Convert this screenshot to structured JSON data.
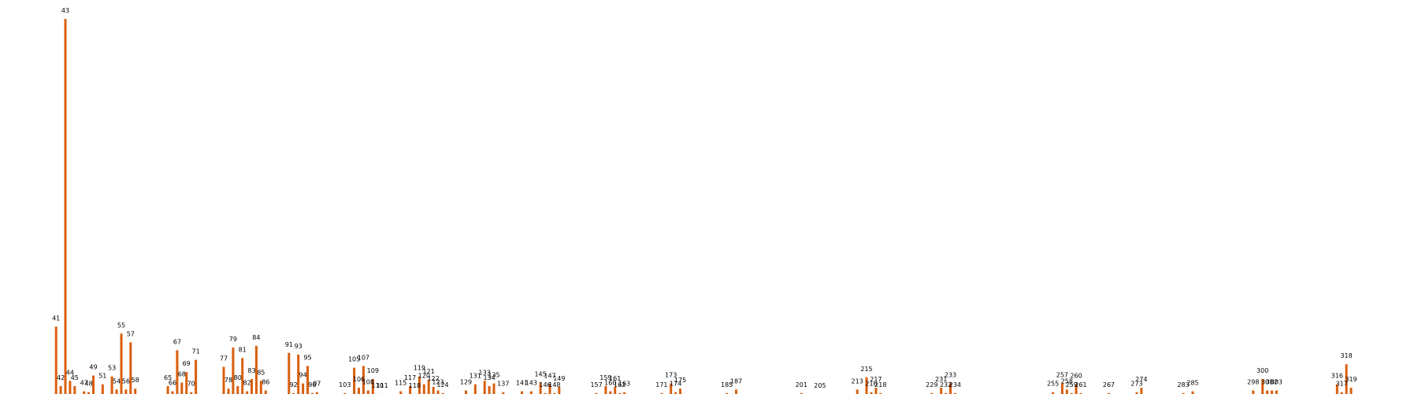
{
  "chart_data": {
    "type": "bar",
    "title": "",
    "xlabel": "",
    "ylabel": "",
    "ylim": [
      0,
      43
    ],
    "grid": false,
    "legend": "none",
    "bar_color": "#d95f0e",
    "categories": [
      41,
      42,
      43,
      44,
      45,
      47,
      48,
      49,
      51,
      53,
      54,
      55,
      56,
      57,
      58,
      65,
      66,
      67,
      68,
      69,
      70,
      71,
      77,
      78,
      79,
      80,
      81,
      82,
      83,
      84,
      85,
      86,
      91,
      92,
      93,
      94,
      95,
      96,
      97,
      103,
      105,
      106,
      107,
      108,
      109,
      110,
      111,
      115,
      117,
      118,
      119,
      120,
      121,
      122,
      123,
      124,
      129,
      131,
      133,
      134,
      135,
      137,
      141,
      143,
      145,
      146,
      147,
      148,
      149,
      157,
      159,
      160,
      161,
      162,
      163,
      171,
      173,
      174,
      175,
      185,
      187,
      201,
      205,
      213,
      215,
      216,
      217,
      218,
      229,
      231,
      232,
      233,
      234,
      255,
      257,
      258,
      259,
      260,
      261,
      267,
      273,
      274,
      283,
      285,
      298,
      300,
      301,
      302,
      303,
      316,
      317,
      318,
      319
    ],
    "values": [
      7.8,
      1,
      43,
      1.6,
      1,
      0.4,
      0.3,
      2.2,
      1.2,
      2.1,
      0.6,
      7,
      0.6,
      6,
      0.7,
      1,
      0.4,
      5.1,
      1.4,
      2.6,
      0.3,
      4,
      3.2,
      0.7,
      5.4,
      1,
      4.2,
      0.4,
      1.8,
      5.6,
      1.6,
      0.5,
      4.8,
      0.2,
      4.6,
      1.3,
      3.3,
      0.2,
      0.3,
      0.2,
      3.1,
      0.8,
      3.3,
      0.5,
      1.8,
      0.1,
      0.1,
      0.4,
      1,
      0.1,
      2.1,
      1.2,
      1.7,
      0.9,
      0.5,
      0.2,
      0.5,
      1.2,
      1.6,
      1,
      1.3,
      0.3,
      0.4,
      0.4,
      1.4,
      0.2,
      1.2,
      0.2,
      0.9,
      0.2,
      1,
      0.4,
      0.9,
      0.2,
      0.3,
      0.2,
      1.3,
      0.3,
      0.7,
      0.2,
      0.6,
      0.2,
      0.1,
      0.6,
      2,
      0.3,
      0.8,
      0.2,
      0.2,
      0.8,
      0.2,
      1.3,
      0.2,
      0.3,
      1.3,
      0.6,
      0.2,
      1.2,
      0.2,
      0.2,
      0.3,
      0.8,
      0.2,
      0.4,
      0.5,
      1.8,
      0.5,
      0.5,
      0.5,
      1.2,
      0.3,
      3.5,
      0.8
    ],
    "labels": [
      "41",
      "42",
      "43",
      "44",
      "45",
      "47",
      "48",
      "49",
      "51",
      "53",
      "54",
      "55",
      "56",
      "57",
      "58",
      "65",
      "66",
      "67",
      "68",
      "69",
      "70",
      "71",
      "77",
      "78",
      "79",
      "80",
      "81",
      "82",
      "83",
      "84",
      "85",
      "86",
      "91",
      "92",
      "93",
      "94",
      "95",
      "96",
      "97",
      "103",
      "105",
      "106",
      "107",
      "108",
      "109",
      "110",
      "111",
      "115",
      "117",
      "118",
      "119",
      "120",
      "121",
      "122",
      "123",
      "124",
      "129",
      "131",
      "133",
      "134",
      "135",
      "137",
      "141",
      "143",
      "145",
      "146",
      "147",
      "148",
      "149",
      "157",
      "159",
      "160",
      "161",
      "162",
      "163",
      "171",
      "173",
      "174",
      "175",
      "185",
      "187",
      "201",
      "205",
      "213",
      "215",
      "216",
      "217",
      "218",
      "229",
      "231",
      "232",
      "233",
      "234",
      "255",
      "257",
      "258",
      "259",
      "260",
      "261",
      "267",
      "273",
      "274",
      "283",
      "285",
      "298",
      "300",
      "301",
      "302",
      "303",
      "316",
      "317",
      "318",
      "319"
    ]
  }
}
